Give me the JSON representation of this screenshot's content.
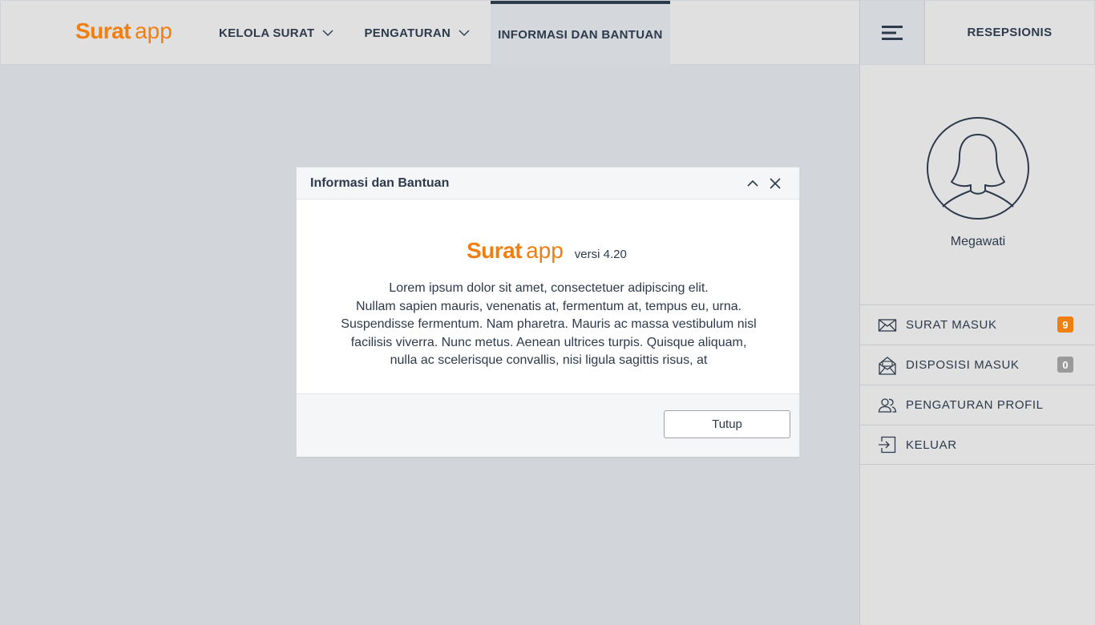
{
  "brand": {
    "name_bold": "Surat",
    "name_light": "app",
    "color": "#f07f10"
  },
  "nav": {
    "items": [
      {
        "label": "KELOLA SURAT",
        "has_dropdown": true
      },
      {
        "label": "PENGATURAN",
        "has_dropdown": true
      },
      {
        "label": "INFORMASI DAN BANTUAN",
        "active": true
      }
    ]
  },
  "header": {
    "menu_icon": "hamburger-icon",
    "role": "RESEPSIONIS"
  },
  "profile": {
    "name": "Megawati",
    "avatar_icon": "user-silhouette-icon"
  },
  "sidebar": {
    "items": [
      {
        "label": "SURAT MASUK",
        "icon": "envelope-icon",
        "badge": "9",
        "badge_color": "#f07f10"
      },
      {
        "label": "DISPOSISI MASUK",
        "icon": "open-envelope-icon",
        "badge": "0",
        "badge_color": "#9a9a9a"
      },
      {
        "label": "PENGATURAN PROFIL",
        "icon": "users-icon"
      },
      {
        "label": "KELUAR",
        "icon": "logout-icon"
      }
    ]
  },
  "modal": {
    "title": "Informasi dan Bantuan",
    "version": "versi 4.20",
    "body_lines": [
      "Lorem ipsum dolor sit amet, consectetuer adipiscing elit.",
      "Nullam sapien mauris, venenatis at, fermentum at, tempus eu, urna.",
      "Suspendisse fermentum. Nam pharetra. Mauris ac massa vestibulum nisl",
      "facilisis viverra. Nunc metus. Aenean ultrices turpis. Quisque aliquam,",
      "nulla ac scelerisque convallis, nisi ligula sagittis risus, at"
    ],
    "close_button": "Tutup"
  }
}
